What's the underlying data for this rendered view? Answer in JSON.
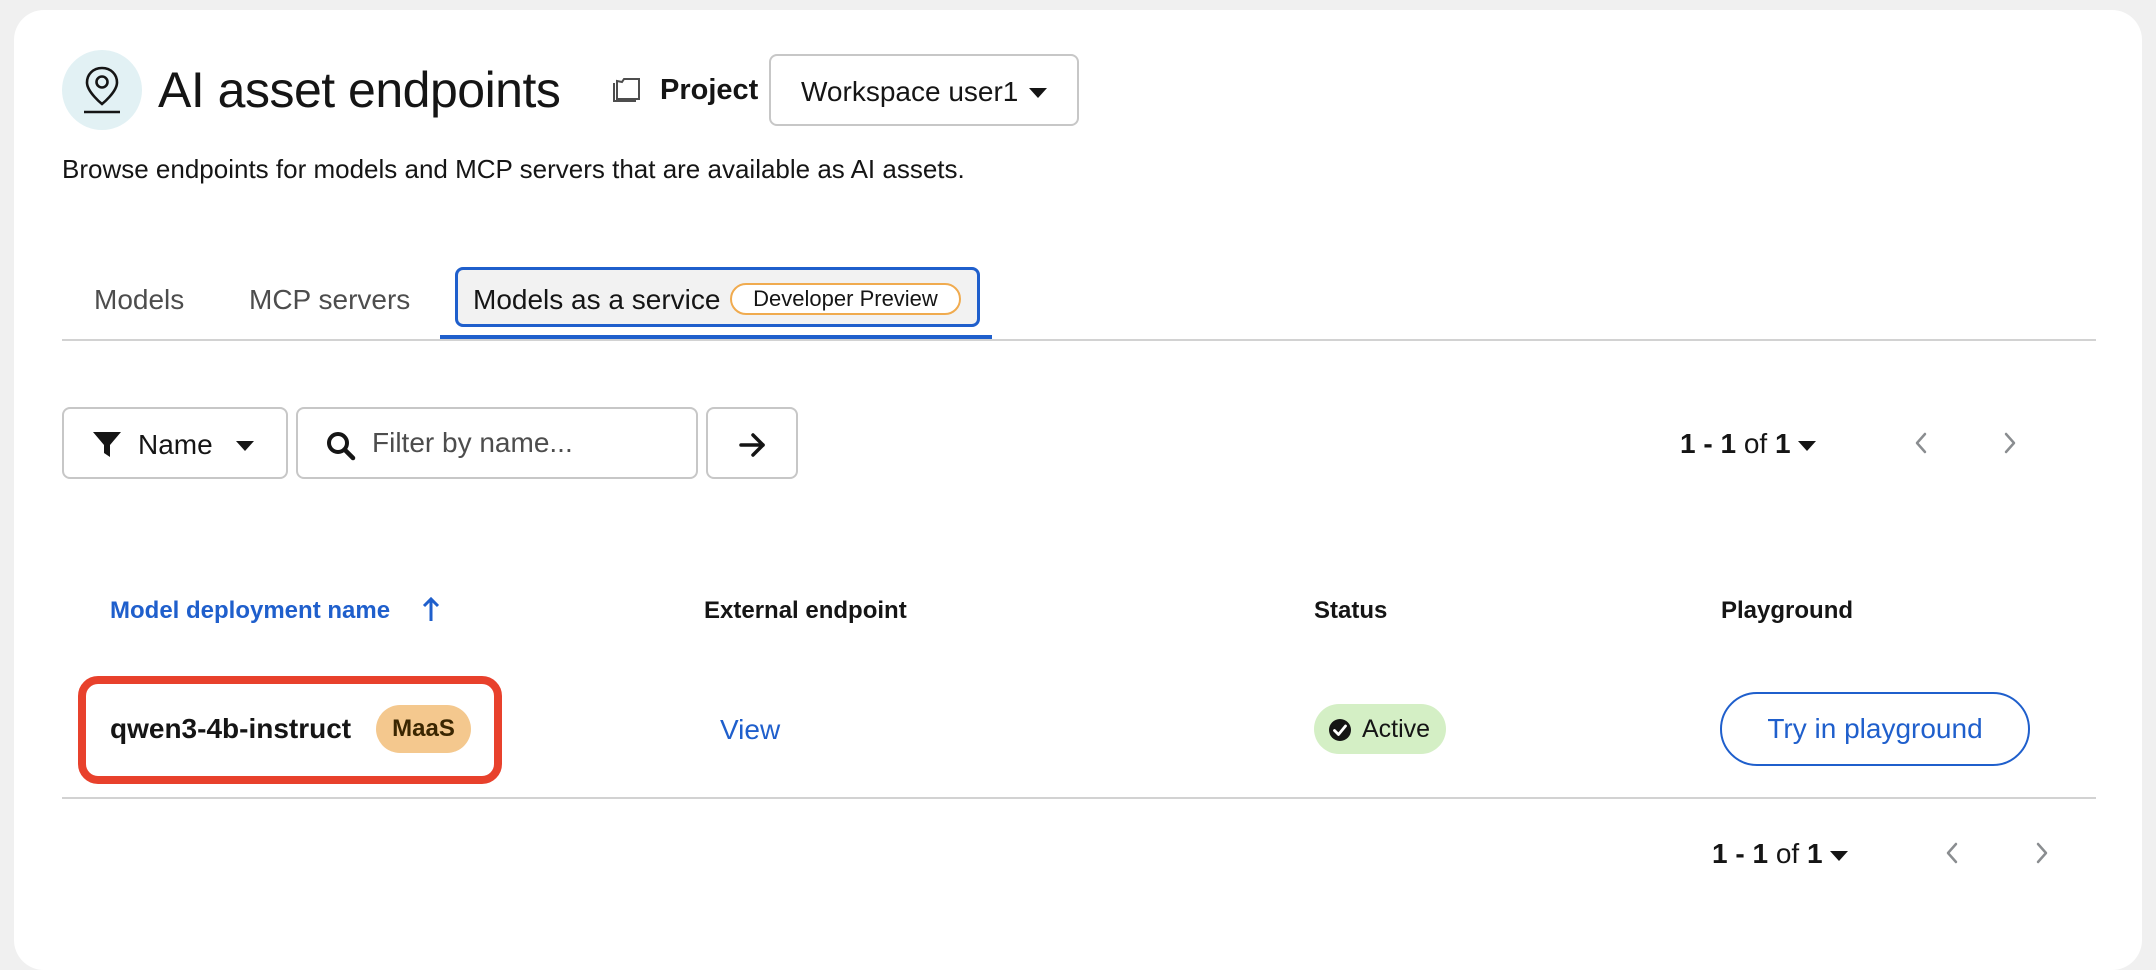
{
  "header": {
    "title": "AI asset endpoints",
    "project_label": "Project",
    "project_selected": "Workspace user1",
    "description": "Browse endpoints for models and MCP servers that are available as AI assets."
  },
  "tabs": [
    {
      "label": "Models",
      "active": false
    },
    {
      "label": "MCP servers",
      "active": false
    },
    {
      "label": "Models as a service",
      "active": true,
      "badge": "Developer Preview"
    }
  ],
  "toolbar": {
    "filter_attribute": "Name",
    "search_placeholder": "Filter by name...",
    "search_value": ""
  },
  "pagination": {
    "range": "1 - 1",
    "of": "of",
    "total": "1"
  },
  "table": {
    "columns": [
      "Model deployment name",
      "External endpoint",
      "Status",
      "Playground"
    ],
    "sorted_column": "Model deployment name",
    "sort_direction": "ascending",
    "rows": [
      {
        "name": "qwen3-4b-instruct",
        "badge": "MaaS",
        "endpoint_link": "View",
        "status": "Active",
        "playground_action": "Try in playground"
      }
    ]
  },
  "colors": {
    "accent": "#1f5fcc",
    "highlight": "#e8412c",
    "status_active_bg": "#d4efc5",
    "maas_badge_bg": "#f4c88e",
    "preview_badge_border": "#f0ab4f"
  },
  "icons": {
    "title": "map-pin-icon",
    "project": "folder-icon",
    "filter": "filter-icon",
    "search": "search-icon",
    "go": "arrow-right-icon",
    "sort": "sort-up-icon",
    "status": "check-circle-icon",
    "pager_prev": "chevron-left-icon",
    "pager_next": "chevron-right-icon"
  }
}
